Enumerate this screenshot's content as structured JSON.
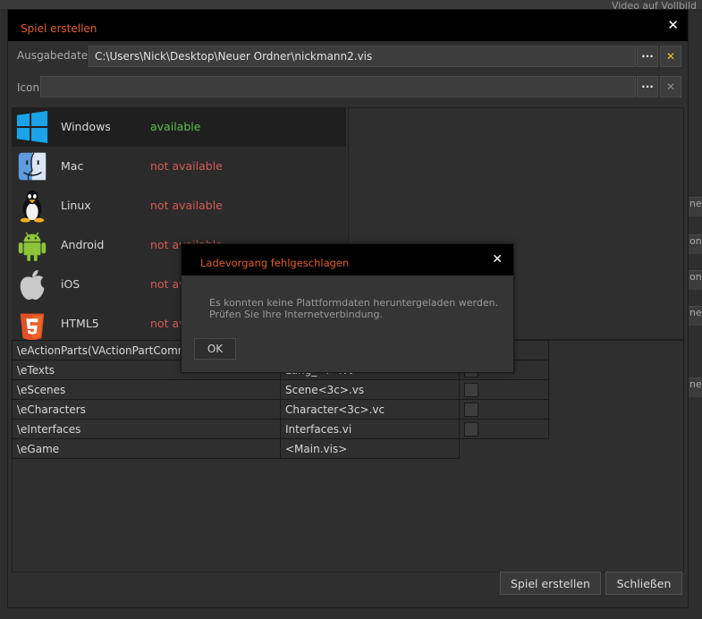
{
  "background": {
    "right_text": "Video auf Vollbild",
    "right_snippets": [
      "ne",
      "on",
      "on",
      "ne",
      "ne"
    ]
  },
  "dialog": {
    "title": "Spiel erstellen",
    "output_label": "Ausgabedatei",
    "output_value": "C:\\Users\\Nick\\Desktop\\Neuer Ordner\\nickmann2.vis",
    "icon_label": "Icon",
    "icon_value": "",
    "browse_label": "···",
    "clear_label": "✕",
    "build_button": "Spiel erstellen",
    "close_button": "Schließen"
  },
  "platforms": [
    {
      "name": "Windows",
      "status": "available",
      "icon": "windows-logo-icon",
      "available": true
    },
    {
      "name": "Mac",
      "status": "not available",
      "icon": "mac-finder-icon",
      "available": false
    },
    {
      "name": "Linux",
      "status": "not available",
      "icon": "linux-tux-icon",
      "available": false
    },
    {
      "name": "Android",
      "status": "not available",
      "icon": "android-robot-icon",
      "available": false
    },
    {
      "name": "iOS",
      "status": "not available",
      "icon": "apple-logo-icon",
      "available": false
    },
    {
      "name": "HTML5",
      "status": "not available",
      "icon": "html5-logo-icon",
      "available": false
    }
  ],
  "params": [
    {
      "name": "\\eActionParts(VActionPartComm",
      "value": "",
      "check": true
    },
    {
      "name": "\\eTexts",
      "value": "Lang_<f>.vt",
      "check": true
    },
    {
      "name": "\\eScenes",
      "value": "Scene<3c>.vs",
      "check": true
    },
    {
      "name": "\\eCharacters",
      "value": "Character<3c>.vc",
      "check": true
    },
    {
      "name": "\\eInterfaces",
      "value": "Interfaces.vi",
      "check": true
    },
    {
      "name": "\\eGame",
      "value": "<Main.vis>",
      "check": false
    }
  ],
  "error_dialog": {
    "title": "Ladevorgang fehlgeschlagen",
    "message_line1": "Es konnten keine Plattformdaten heruntergeladen werden.",
    "message_line2": "Prüfen Sie Ihre Internetverbindung.",
    "ok_label": "OK"
  },
  "colors": {
    "accent": "#e0602a",
    "available": "#5bbf4a",
    "not_available": "#d65a55",
    "clear_active": "#f0c020"
  }
}
